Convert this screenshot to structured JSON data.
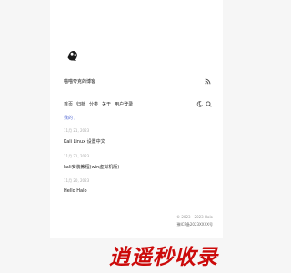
{
  "site": {
    "title": "喵喵夸克的博客",
    "rss_icon": "rss-icon"
  },
  "nav": {
    "items": [
      "首页",
      "归档",
      "分类",
      "关于",
      "用户登录"
    ],
    "theme_icon": "theme-toggle-icon",
    "search_icon": "search-icon"
  },
  "current_label": "我的 / ",
  "posts": [
    {
      "date": "11月 21, 2023",
      "title": "Kali Linux 设置中文"
    },
    {
      "date": "11月 21, 2023",
      "title": "kali安装教程(win虚拟机版)"
    },
    {
      "date": "11月 20, 2023",
      "title": "Hello Halo"
    }
  ],
  "footer": {
    "copyright": "© 2023 - 2023 Halo",
    "icp": "豫ICP备2023XXXX号"
  },
  "watermark": "逍遥秒收录"
}
